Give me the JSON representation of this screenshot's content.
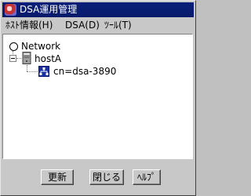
{
  "window": {
    "title": "DSA運用管理"
  },
  "menu": [
    {
      "label": "ﾎｽﾄ情報(H)"
    },
    {
      "label": "DSA(D)"
    },
    {
      "label": "ﾂｰﾙ(T)"
    }
  ],
  "tree": {
    "root": {
      "label": "Network"
    },
    "host": {
      "label": "hostA"
    },
    "dsa": {
      "label": "cn=dsa-3890"
    }
  },
  "buttons": {
    "refresh": "更新",
    "close": "閉じる",
    "help": "ﾍﾙﾌﾟ"
  },
  "colors": {
    "titlebar": "#0a1f7a",
    "window_bg": "#c8c8c8",
    "tree_bg": "#ffffff"
  }
}
